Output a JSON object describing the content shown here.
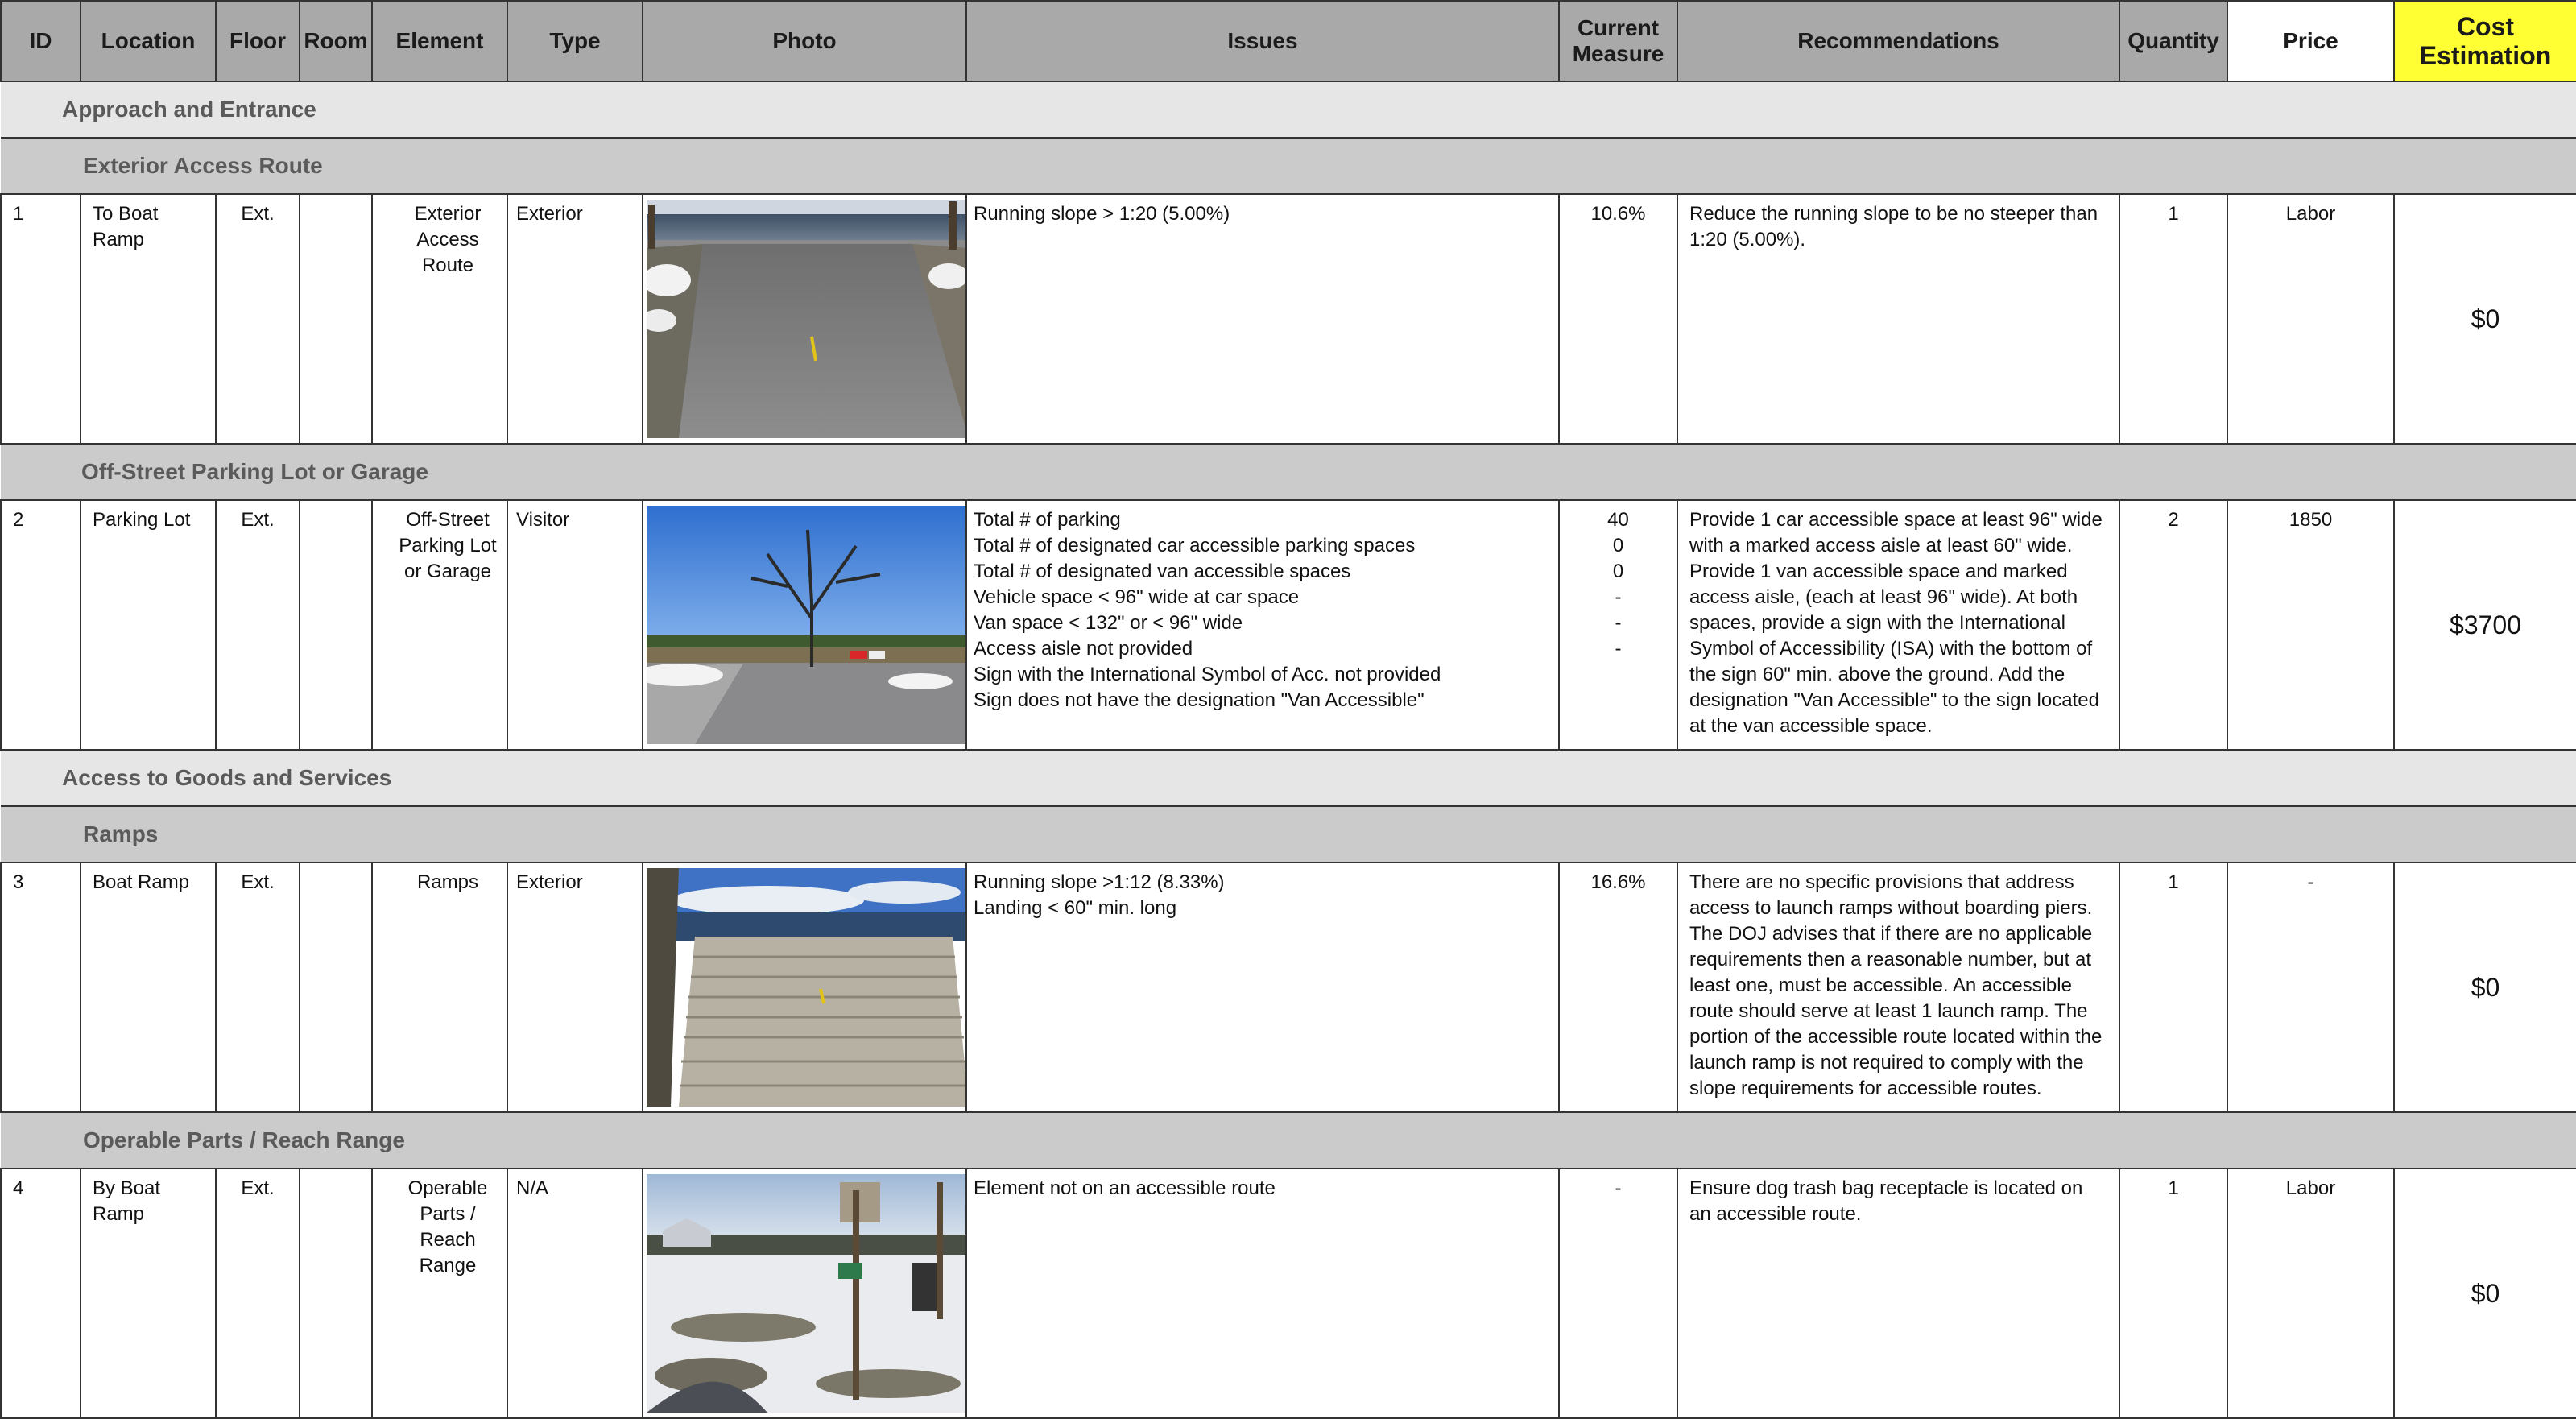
{
  "header": {
    "id": "ID",
    "location": "Location",
    "floor": "Floor",
    "room": "Room",
    "element": "Element",
    "type": "Type",
    "photo": "Photo",
    "issues": "Issues",
    "current_measure": "Current Measure",
    "recommendations": "Recommendations",
    "quantity": "Quantity",
    "price": "Price",
    "cost_estimation": "Cost Estimation"
  },
  "colors": {
    "header_gray": "#a9a9a9",
    "cost_yellow": "#ffff33",
    "section_light": "#e6e6e6",
    "section_mid": "#cbcbcb"
  },
  "sections": [
    {
      "title": "Approach and Entrance",
      "subsections": [
        {
          "title": "Exterior Access Route",
          "rows": [
            {
              "id": "1",
              "location": "To Boat Ramp",
              "floor": "Ext.",
              "room": "",
              "element": "Exterior Access Route",
              "type": "Exterior",
              "photo_desc": "photo-paved-path-to-water",
              "issues": "Running slope > 1:20 (5.00%)",
              "current_measure": "10.6%",
              "recommendations": "Reduce the running slope to be no steeper than 1:20 (5.00%).",
              "quantity": "1",
              "price": "Labor",
              "cost": "$0"
            }
          ]
        },
        {
          "title": "Off-Street Parking Lot or Garage",
          "rows": [
            {
              "id": "2",
              "location": "Parking Lot",
              "floor": "Ext.",
              "room": "",
              "element": "Off-Street Parking Lot or Garage",
              "type": "Visitor",
              "photo_desc": "photo-parking-lot-with-tree",
              "issues": "Total # of parking\nTotal # of designated car accessible parking spaces\nTotal # of designated van accessible spaces\nVehicle space < 96\" wide at car space\nVan space < 132\" or < 96\" wide\nAccess aisle not provided\nSign with the International Symbol of Acc. not provided\n Sign does not have the designation \"Van Accessible\"",
              "current_measure": "40\n0\n0\n-\n-\n-",
              "recommendations": "Provide 1 car accessible space at least 96\" wide with a marked access aisle at least 60\" wide. Provide 1 van accessible space and marked access aisle, (each at least 96\" wide). At both spaces, provide a sign with the International Symbol of Accessibility (ISA) with the bottom of the sign 60\" min. above the ground. Add the designation \"Van Accessible\" to the sign located at the van accessible space.",
              "quantity": "2",
              "price": "1850",
              "cost": "$3700"
            }
          ]
        }
      ]
    },
    {
      "title": "Access to Goods and Services",
      "subsections": [
        {
          "title": "Ramps",
          "rows": [
            {
              "id": "3",
              "location": "Boat Ramp",
              "floor": "Ext.",
              "room": "",
              "element": "Ramps",
              "type": "Exterior",
              "photo_desc": "photo-concrete-boat-ramp",
              "issues": "Running slope >1:12 (8.33%)\n Landing < 60\" min. long",
              "current_measure": "16.6%",
              "recommendations": "There are no specific provisions that address access to launch ramps without boarding piers. The DOJ advises that if there are no applicable requirements  then a reasonable number, but at least one, must be accessible. An accessible route should serve at least 1 launch ramp. The portion of the accessible route located within the launch ramp is not required to comply with the slope requirements for accessible routes.",
              "quantity": "1",
              "price": "-",
              "cost": "$0"
            }
          ]
        },
        {
          "title": "Operable Parts / Reach Range",
          "rows": [
            {
              "id": "4",
              "location": "By Boat Ramp",
              "floor": "Ext.",
              "room": "",
              "element": "Operable Parts / Reach Range",
              "type": "N/A",
              "photo_desc": "photo-snowy-field-with-sign",
              "issues": "Element not on an accessible route",
              "current_measure": "-",
              "recommendations": "Ensure dog trash bag receptacle is located on an accessible route.",
              "quantity": "1",
              "price": "Labor",
              "cost": "$0"
            }
          ]
        }
      ]
    }
  ]
}
